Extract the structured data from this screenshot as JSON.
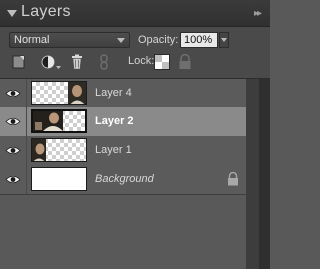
{
  "panel": {
    "title": "Layers",
    "menu_glyph": "▸▸"
  },
  "controls": {
    "blend_mode": "Normal",
    "opacity_label": "Opacity:",
    "opacity_value": "100%",
    "lock_label": "Lock:"
  },
  "layers": [
    {
      "name": "Layer 4",
      "selected": false,
      "visible": true,
      "italic": false,
      "locked": false,
      "thumb": "photo-right"
    },
    {
      "name": "Layer 2",
      "selected": true,
      "visible": true,
      "italic": false,
      "locked": false,
      "thumb": "photo-left"
    },
    {
      "name": "Layer 1",
      "selected": false,
      "visible": true,
      "italic": false,
      "locked": false,
      "thumb": "photo-corner"
    },
    {
      "name": "Background",
      "selected": false,
      "visible": true,
      "italic": true,
      "locked": true,
      "thumb": "white"
    }
  ],
  "colors": {
    "panel_bg": "#595959",
    "selected_row": "#8a8a8a",
    "title_bar": "#333333"
  }
}
